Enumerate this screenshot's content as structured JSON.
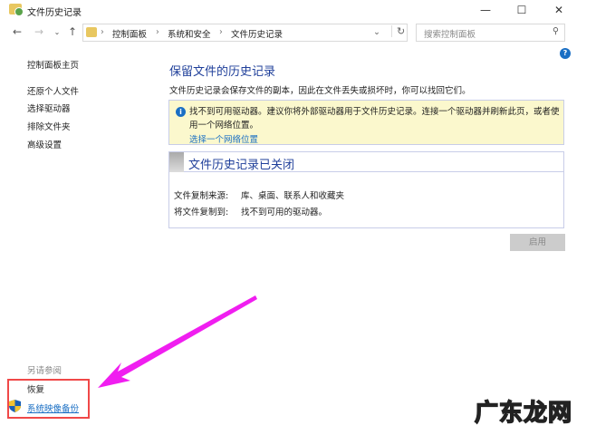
{
  "window": {
    "title": "文件历史记录",
    "minimize": "—",
    "maximize": "☐",
    "close": "✕"
  },
  "address": {
    "crumbs": [
      "控制面板",
      "系统和安全",
      "文件历史记录"
    ],
    "sep": "›",
    "search_placeholder": "搜索控制面板"
  },
  "sidebar": {
    "home": "控制面板主页",
    "items": [
      "还原个人文件",
      "选择驱动器",
      "排除文件夹",
      "高级设置"
    ],
    "see_also": "另请参阅",
    "links": [
      "恢复",
      "系统映像备份"
    ]
  },
  "main": {
    "title": "保留文件的历史记录",
    "description": "文件历史记录会保存文件的副本，因此在文件丢失或损坏时，你可以找回它们。",
    "info": {
      "text": "找不到可用驱动器。建议你将外部驱动器用于文件历史记录。连接一个驱动器并刷新此页，或者使用一个网络位置。",
      "link": "选择一个网络位置"
    },
    "status": {
      "title": "文件历史记录已关闭",
      "rows": [
        {
          "label": "文件复制来源:",
          "value": "库、桌面、联系人和收藏夹"
        },
        {
          "label": "将文件复制到:",
          "value": "找不到可用的驱动器。"
        }
      ]
    },
    "enable_button": "启用"
  },
  "watermark": "广东龙网",
  "colors": {
    "accent": "#1a6fc4",
    "arrow": "#f01ef0",
    "highlight": "#f04848"
  }
}
